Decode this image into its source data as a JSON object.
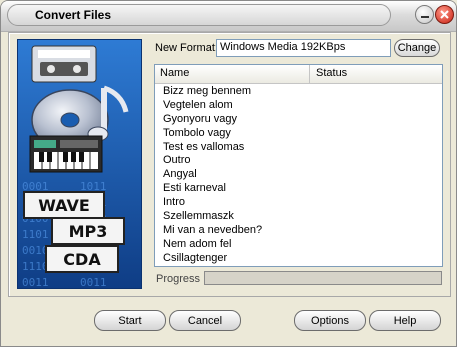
{
  "window": {
    "title": "Convert Files"
  },
  "format": {
    "label": "New Format:",
    "value": "Windows Media 192KBps",
    "change_label": "Change"
  },
  "list": {
    "columns": [
      "Name",
      "Status"
    ],
    "rows": [
      "Bizz meg bennem",
      "Vegtelen alom",
      "Gyonyoru vagy",
      "Tombolo vagy",
      "Test es vallomas",
      "Outro",
      "Angyal",
      "Esti karneval",
      "Intro",
      "Szellemmaszk",
      "Mi van a nevedben?",
      "Nem adom fel",
      "Csillagtenger"
    ]
  },
  "progress": {
    "label": "Progress",
    "value": 0
  },
  "buttons": {
    "start": "Start",
    "cancel": "Cancel",
    "options": "Options",
    "help": "Help"
  },
  "art": {
    "tags": [
      "WAVE",
      "MP3",
      "CDA"
    ],
    "icons": [
      "cassette-icon",
      "cd-disc-icon",
      "music-note-icon",
      "keyboard-icon"
    ]
  },
  "colors": {
    "art_background": "#1a5db0",
    "close_button": "#c81e10",
    "window": "#ece9d8"
  }
}
